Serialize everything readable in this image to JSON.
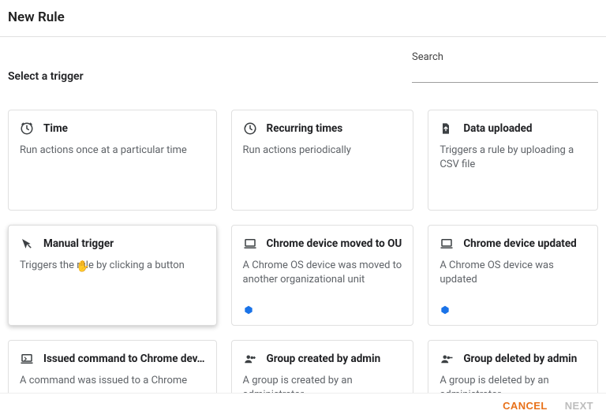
{
  "header": {
    "title": "New Rule"
  },
  "subheader": {
    "title": "Select a trigger"
  },
  "search": {
    "label": "Search",
    "value": ""
  },
  "cards": [
    {
      "icon": "clock-icon",
      "title": "Time",
      "desc": "Run actions once at a particular time",
      "badge": false
    },
    {
      "icon": "recurring-icon",
      "title": "Recurring times",
      "desc": "Run actions periodically",
      "badge": false
    },
    {
      "icon": "file-upload-icon",
      "title": "Data uploaded",
      "desc": "Triggers a rule by uploading a CSV file",
      "badge": false
    },
    {
      "icon": "cursor-click-icon",
      "title": "Manual trigger",
      "desc": "Triggers the rule by clicking a button",
      "badge": false,
      "selected": true
    },
    {
      "icon": "laptop-icon",
      "title": "Chrome device moved to OU",
      "desc": "A Chrome OS device was moved to another organizational unit",
      "badge": true
    },
    {
      "icon": "laptop-icon",
      "title": "Chrome device updated",
      "desc": "A Chrome OS device was updated",
      "badge": true
    },
    {
      "icon": "laptop-command-icon",
      "title": "Issued command to Chrome dev…",
      "desc": "A command was issued to a Chrome",
      "badge": false
    },
    {
      "icon": "group-add-icon",
      "title": "Group created by admin",
      "desc": "A group is created by an administrator",
      "badge": false
    },
    {
      "icon": "group-remove-icon",
      "title": "Group deleted by admin",
      "desc": "A group is deleted by an administrator",
      "badge": false
    }
  ],
  "footer": {
    "cancel": "Cancel",
    "next": "Next"
  }
}
